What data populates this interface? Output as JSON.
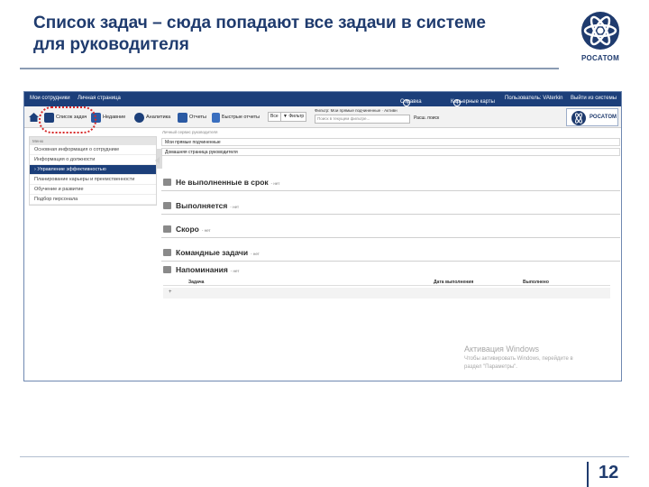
{
  "slide": {
    "title_line1": "Список задач – сюда попадают все задачи в системе",
    "title_line2": "для руководителя",
    "logo_text": "РОСАТОМ",
    "page_number": "12"
  },
  "app": {
    "topbar": {
      "left_links": [
        "Мои сотрудники",
        "Личная страница"
      ],
      "right_links": [
        "Справка",
        "Карьерные карты",
        "Пользователь: VAterkin",
        "Выйти из системы"
      ]
    },
    "toolbar": {
      "items": [
        "Список задач",
        "Недавние",
        "Аналитика",
        "Отчеты",
        "Быстрые отчеты"
      ],
      "all_label": "Все",
      "filter_label": "Фильтр",
      "filter_line": "Фильтр: Мои прямые подчиненные · Активн",
      "search_placeholder": "Поиск в текущем фильтре...",
      "advanced_search": "Расш. поиск",
      "logo_text": "РОСАТОМ"
    },
    "menu": {
      "header": "Меню",
      "items": [
        "Основная информация о сотруднике",
        "Информация о должности",
        "Управление эффективностью",
        "Планирование карьеры и преемственности",
        "Обучение и развитие",
        "Подбор персонала"
      ],
      "active_prefix": "›"
    },
    "main": {
      "breadcrumb": "Личный сервис руководителя",
      "select_value": "Мои прямые подчиненные",
      "home_label": "Домашняя страница руководителя",
      "sections": [
        {
          "title": "Не выполненные в срок",
          "count": "- нет"
        },
        {
          "title": "Выполняется",
          "count": "- нет"
        },
        {
          "title": "Скоро",
          "count": "- нет"
        },
        {
          "title": "Командные задачи",
          "count": "- нет"
        },
        {
          "title": "Напоминания",
          "count": "- нет"
        }
      ],
      "table": {
        "headers": [
          "Задача",
          "Дата выполнения",
          "Выполнено"
        ],
        "row_marker": "+"
      }
    },
    "watermark": {
      "line1": "Активация Windows",
      "line2": "Чтобы активировать Windows, перейдите в",
      "line3": "раздел \"Параметры\"."
    }
  },
  "colors": {
    "title": "#1f3b6e",
    "topbar": "#1c3f7a",
    "highlight_ring": "#d62828"
  }
}
